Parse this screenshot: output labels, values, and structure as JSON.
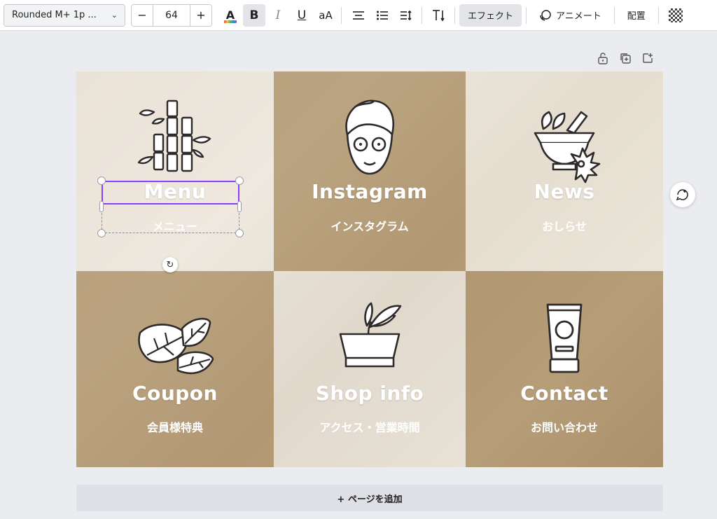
{
  "toolbar": {
    "font_name": "Rounded M+ 1p ...",
    "font_size": "64",
    "decrease": "−",
    "increase": "+",
    "text_color_glyph": "A",
    "bold": "B",
    "italic": "I",
    "underline": "U",
    "case": "aA",
    "effects_label": "エフェクト",
    "animate_label": "アニメート",
    "position_label": "配置"
  },
  "tiles": [
    {
      "title": "Menu",
      "subtitle": "メニュー",
      "icon": "bamboo-icon"
    },
    {
      "title": "Instagram",
      "subtitle": "インスタグラム",
      "icon": "face-mask-icon"
    },
    {
      "title": "News",
      "subtitle": "おしらせ",
      "icon": "mortar-herbs-icon"
    },
    {
      "title": "Coupon",
      "subtitle": "会員様特典",
      "icon": "leaves-icon"
    },
    {
      "title": "Shop info",
      "subtitle": "アクセス・営業時間",
      "icon": "plant-pot-icon"
    },
    {
      "title": "Contact",
      "subtitle": "お問い合わせ",
      "icon": "cosmetic-tube-icon"
    }
  ],
  "add_page_label": "+ ページを追加",
  "colors": {
    "selection": "#8b3dff",
    "toolbar_bg": "#ffffff",
    "workspace_bg": "#ebecf0"
  }
}
